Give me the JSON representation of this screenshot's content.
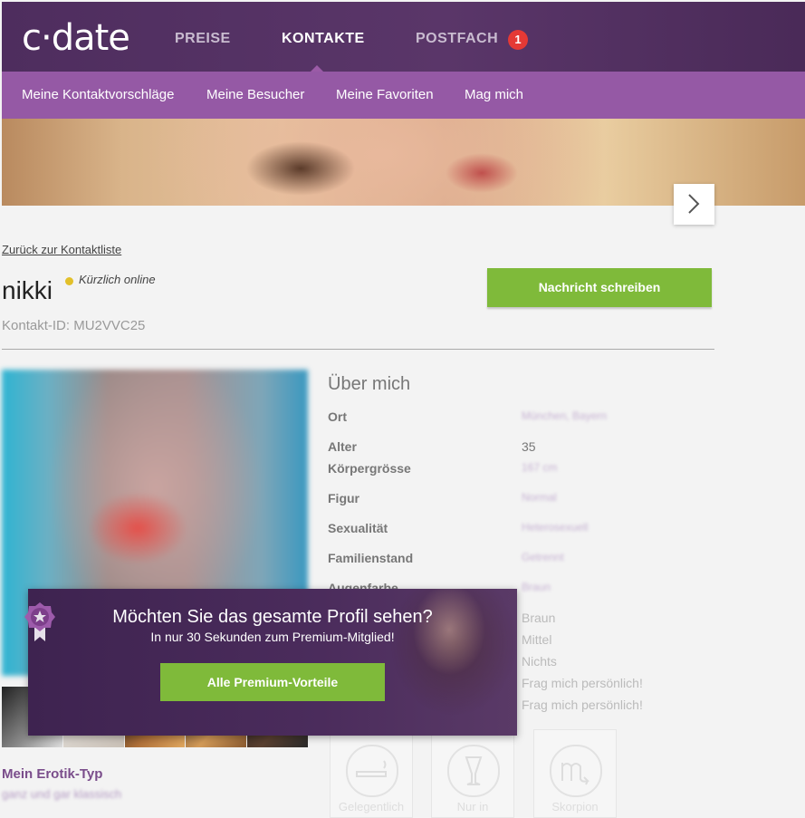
{
  "brand": {
    "logo_text": "c·date"
  },
  "nav": {
    "items": [
      {
        "label": "PREISE"
      },
      {
        "label": "KONTAKTE"
      },
      {
        "label": "POSTFACH",
        "badge": "1"
      }
    ]
  },
  "subnav": {
    "items": [
      {
        "label": "Meine Kontaktvorschläge"
      },
      {
        "label": "Meine Besucher"
      },
      {
        "label": "Meine Favoriten"
      },
      {
        "label": "Mag mich"
      }
    ]
  },
  "profile": {
    "back_link": "Zurück zur Kontaktliste",
    "name": "nikki",
    "status": "Kürzlich online",
    "contact_id": "Kontakt-ID: MU2VVC25",
    "message_button": "Nachricht schreiben",
    "erotik_title": "Mein Erotik-Typ",
    "erotik_value": "ganz und gar klassisch"
  },
  "about": {
    "title": "Über mich",
    "rows": [
      {
        "label": "Ort",
        "value": "München, Bayern",
        "blurred": true
      },
      {
        "label": "Alter",
        "value": "35",
        "blurred": false
      },
      {
        "label": "Körpergrösse",
        "value": "167 cm",
        "blurred": true
      },
      {
        "label": "Figur",
        "value": "Normal",
        "blurred": true
      },
      {
        "label": "Sexualität",
        "value": "Heterosexuell",
        "blurred": true
      },
      {
        "label": "Familienstand",
        "value": "Getrennt",
        "blurred": true
      },
      {
        "label": "Augenfarbe",
        "value": "Braun",
        "blurred": true
      }
    ],
    "more_values": [
      "Braun",
      "Mittel",
      "Nichts",
      "Frag mich persönlich!",
      "Frag mich persönlich!"
    ]
  },
  "premium_overlay": {
    "headline": "Möchten Sie das gesamte Profil sehen?",
    "subline": "In nur 30 Sekunden zum Premium-Mitglied!",
    "button": "Alle Premium-Vorteile"
  },
  "lifestyle_icons": [
    {
      "icon": "cigarette-icon",
      "label": "Gelegentlich"
    },
    {
      "icon": "wine-glass-icon",
      "label": "Nur in"
    },
    {
      "icon": "scorpio-icon",
      "label": "Skorpion"
    }
  ],
  "colors": {
    "header": "#4e2d5e",
    "subnav": "#9559a5",
    "accent_green": "#7fba3a",
    "badge_red": "#e53935",
    "erotik_purple": "#7a4d8b"
  }
}
